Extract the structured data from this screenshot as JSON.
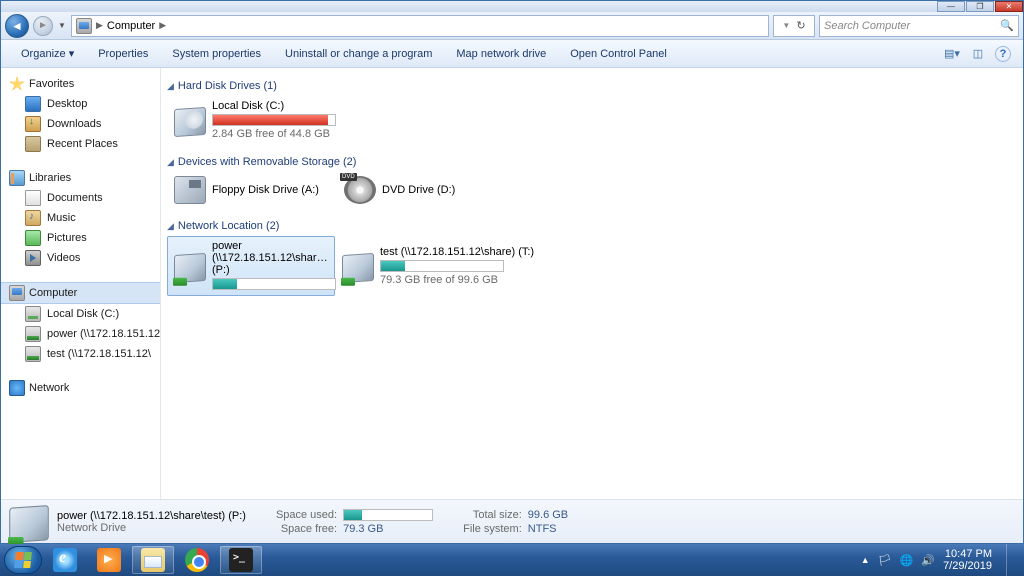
{
  "titlebar": {
    "min": "—",
    "max": "❐",
    "close": "✕"
  },
  "address": {
    "location": "Computer",
    "sep": "▶",
    "search_placeholder": "Search Computer",
    "refresh": "↻"
  },
  "toolbar": {
    "organize": "Organize ▾",
    "properties": "Properties",
    "system_properties": "System properties",
    "uninstall": "Uninstall or change a program",
    "map_drive": "Map network drive",
    "control_panel": "Open Control Panel"
  },
  "nav": {
    "favorites": {
      "label": "Favorites",
      "items": [
        "Desktop",
        "Downloads",
        "Recent Places"
      ]
    },
    "libraries": {
      "label": "Libraries",
      "items": [
        "Documents",
        "Music",
        "Pictures",
        "Videos"
      ]
    },
    "computer": {
      "label": "Computer",
      "items": [
        "Local Disk (C:)",
        "power (\\\\172.18.151.12",
        "test (\\\\172.18.151.12\\"
      ]
    },
    "network": {
      "label": "Network"
    }
  },
  "groups": {
    "hdd": {
      "title": "Hard Disk Drives (1)",
      "local_c": {
        "name": "Local Disk (C:)",
        "sub": "2.84 GB free of 44.8 GB",
        "fill_pct": 94
      }
    },
    "removable": {
      "title": "Devices with Removable Storage (2)",
      "floppy": {
        "name": "Floppy Disk Drive (A:)"
      },
      "dvd": {
        "name": "DVD Drive (D:)"
      }
    },
    "network": {
      "title": "Network Location (2)",
      "p": {
        "name": "power (\\\\172.18.151.12\\share\\test) (P:)",
        "fill_pct": 20
      },
      "t": {
        "name": "test (\\\\172.18.151.12\\share) (T:)",
        "sub": "79.3 GB free of 99.6 GB",
        "fill_pct": 20
      }
    }
  },
  "details": {
    "title": "power (\\\\172.18.151.12\\share\\test) (P:)",
    "subtitle": "Network Drive",
    "space_used_lbl": "Space used:",
    "space_free_lbl": "Space free:",
    "space_free_val": "79.3 GB",
    "total_size_lbl": "Total size:",
    "total_size_val": "99.6 GB",
    "fs_lbl": "File system:",
    "fs_val": "NTFS",
    "fill_pct": 20
  },
  "taskbar": {
    "time": "10:47 PM",
    "date": "7/29/2019",
    "flag": "🏳",
    "vol": "🔊",
    "net": "🌐"
  }
}
